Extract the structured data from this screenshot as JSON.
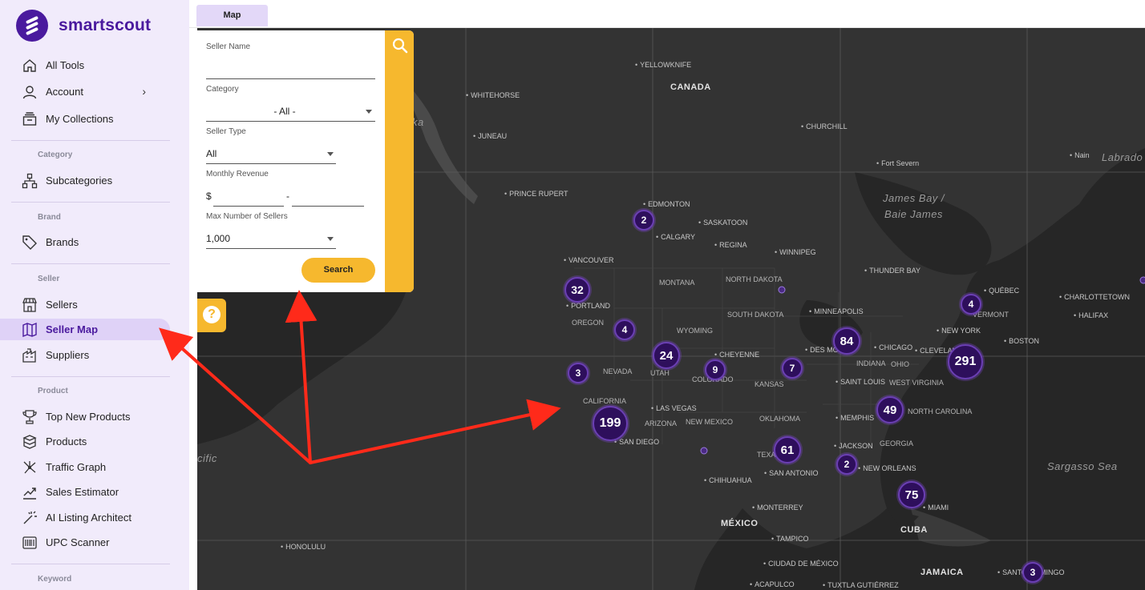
{
  "brand": {
    "name": "smartscout"
  },
  "tabs": [
    {
      "label": "Map"
    }
  ],
  "sidebar": {
    "items": [
      {
        "label": "All Tools",
        "icon": "home-icon"
      },
      {
        "label": "Account",
        "icon": "user-icon",
        "chevron": "›"
      },
      {
        "label": "My Collections",
        "icon": "collections-icon"
      }
    ],
    "sections": [
      {
        "label": "Category",
        "items": [
          {
            "label": "Subcategories",
            "icon": "hierarchy-icon"
          }
        ]
      },
      {
        "label": "Brand",
        "items": [
          {
            "label": "Brands",
            "icon": "tag-icon"
          }
        ]
      },
      {
        "label": "Seller",
        "items": [
          {
            "label": "Sellers",
            "icon": "store-icon"
          },
          {
            "label": "Seller Map",
            "icon": "map-icon",
            "active": true
          },
          {
            "label": "Suppliers",
            "icon": "supplier-icon"
          }
        ]
      },
      {
        "label": "Product",
        "items": [
          {
            "label": "Top New Products",
            "icon": "trophy-icon"
          },
          {
            "label": "Products",
            "icon": "boxes-icon"
          },
          {
            "label": "Traffic Graph",
            "icon": "graph-icon"
          },
          {
            "label": "Sales Estimator",
            "icon": "chart-up-icon"
          },
          {
            "label": "AI Listing Architect",
            "icon": "magic-wand-icon"
          },
          {
            "label": "UPC Scanner",
            "icon": "barcode-icon"
          }
        ]
      },
      {
        "label": "Keyword",
        "items": []
      }
    ]
  },
  "filters": {
    "seller_name": {
      "label": "Seller Name",
      "value": ""
    },
    "category": {
      "label": "Category",
      "value": "- All -"
    },
    "seller_type": {
      "label": "Seller Type",
      "value": "All"
    },
    "monthly_revenue": {
      "label": "Monthly Revenue",
      "currency": "$",
      "separator": "-",
      "min": "",
      "max": ""
    },
    "max_sellers": {
      "label": "Max Number of Sellers",
      "value": "1,000"
    },
    "search_label": "Search",
    "help_label": "?"
  },
  "map": {
    "countries": [
      "CANADA",
      "MÉXICO",
      "CUBA",
      "JAMAICA"
    ],
    "seas": [
      "James Bay /",
      "Baie James",
      "Sargasso Sea",
      "Labrado",
      "ka",
      "cific"
    ],
    "states": [
      "MONTANA",
      "NORTH DAKOTA",
      "SOUTH DAKOTA",
      "WYOMING",
      "OREGON",
      "NEVADA",
      "UTAH",
      "COLORADO",
      "KANSAS",
      "OKLAHOMA",
      "ARIZONA",
      "NEW MEXICO",
      "TEXAS",
      "CALIFORNIA",
      "INDIANA",
      "OHIO",
      "WEST VIRGINIA",
      "NORTH CAROLINA",
      "GEORGIA",
      "VERMONT"
    ],
    "cities": [
      "YELLOWKNIFE",
      "WHITEHORSE",
      "CHURCHILL",
      "Fort Severn",
      "Nain",
      "JUNEAU",
      "PRINCE RUPERT",
      "EDMONTON",
      "SASKATOON",
      "CALGARY",
      "REGINA",
      "WINNIPEG",
      "VANCOUVER",
      "THUNDER BAY",
      "PORTLAND",
      "QUÉBEC",
      "CHARLOTTETOWN",
      "HALIFAX",
      "MINNEAPOLIS",
      "CHEYENNE",
      "DES MOINES",
      "CHICAGO",
      "CLEVELAND",
      "NEW YORK",
      "BOSTON",
      "SAINT LOUIS",
      "LAS VEGAS",
      "MEMPHIS",
      "SAN DIEGO",
      "JACKSON",
      "NEW ORLEANS",
      "SAN ANTONIO",
      "CHIHUAHUA",
      "MIAMI",
      "MONTERREY",
      "TAMPICO",
      "HONOLULU",
      "CIUDAD DE MÉXICO",
      "ACAPULCO",
      "TUXTLA GUTIÉRREZ",
      "SANTO DOMINGO"
    ],
    "clusters": [
      {
        "label": "2"
      },
      {
        "label": "32"
      },
      {
        "label": "4"
      },
      {
        "label": "24"
      },
      {
        "label": "9"
      },
      {
        "label": "7"
      },
      {
        "label": "84"
      },
      {
        "label": "4"
      },
      {
        "label": "291"
      },
      {
        "label": "3"
      },
      {
        "label": "199"
      },
      {
        "label": "49"
      },
      {
        "label": "61"
      },
      {
        "label": "2"
      },
      {
        "label": "75"
      },
      {
        "label": "3"
      }
    ]
  },
  "colors": {
    "accent": "#4a1a9e",
    "yellow": "#f6b82e",
    "map_bg": "#262626",
    "arrow": "#ff2a1a"
  }
}
